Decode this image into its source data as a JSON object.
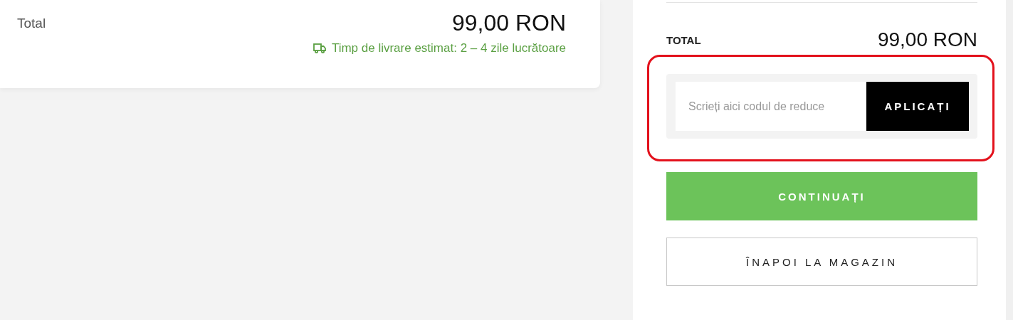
{
  "order_card": {
    "total_label": "Total",
    "total_value": "99,00 RON",
    "delivery": "Timp de livrare estimat: 2 – 4 zile lucrătoare"
  },
  "summary": {
    "total_label": "TOTAL",
    "total_value": "99,00 RON",
    "discount": {
      "placeholder": "Scrieți aici codul de reduce",
      "button": "APLICAȚI",
      "highlighted": true
    },
    "buttons": [
      {
        "label": "CONTINUAȚI",
        "kind": "primary"
      },
      {
        "label": "ÎNAPOI LA MAGAZIN",
        "kind": "outline"
      }
    ]
  }
}
